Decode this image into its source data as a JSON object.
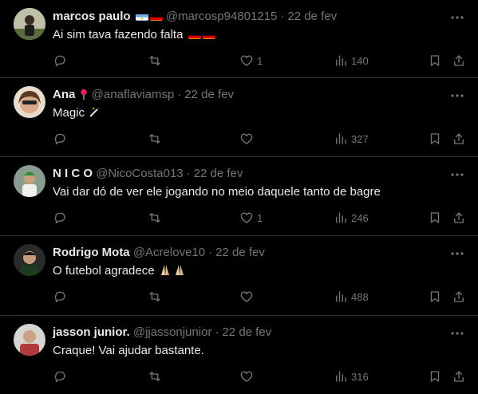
{
  "tweets": [
    {
      "name": "marcos paulo",
      "handle": "@marcosp94801215",
      "date": "22 de fev",
      "text": "Ai sim tava fazendo falta",
      "likes": "1",
      "views": "140",
      "name_flags": [
        "argentina",
        "germany"
      ],
      "text_flags": [
        "germany",
        "germany"
      ]
    },
    {
      "name": "Ana",
      "handle": "@anaflaviamsp",
      "date": "22 de fev",
      "text": "Magic",
      "likes": "",
      "views": "327",
      "name_emoji": "pin",
      "text_emoji": "magic-wand"
    },
    {
      "name": "N I C O",
      "handle": "@NicoCosta013",
      "date": "22 de fev",
      "text": "Vai dar dó de ver ele jogando no meio daquele tanto de bagre",
      "likes": "1",
      "views": "246"
    },
    {
      "name": "Rodrigo Mota",
      "handle": "@Acrelove10",
      "date": "22 de fev",
      "text": "O futebol agradece",
      "likes": "",
      "views": "488",
      "text_emoji": "folded-hands"
    },
    {
      "name": "jasson junior.",
      "handle": "@jjassonjunior",
      "date": "22 de fev",
      "text": "Craque! Vai ajudar bastante.",
      "likes": "",
      "views": "316"
    }
  ],
  "separator": "·",
  "colors": {
    "background": "#000000",
    "text": "#e7e9ea",
    "muted": "#71767b",
    "border": "#2f3336"
  }
}
